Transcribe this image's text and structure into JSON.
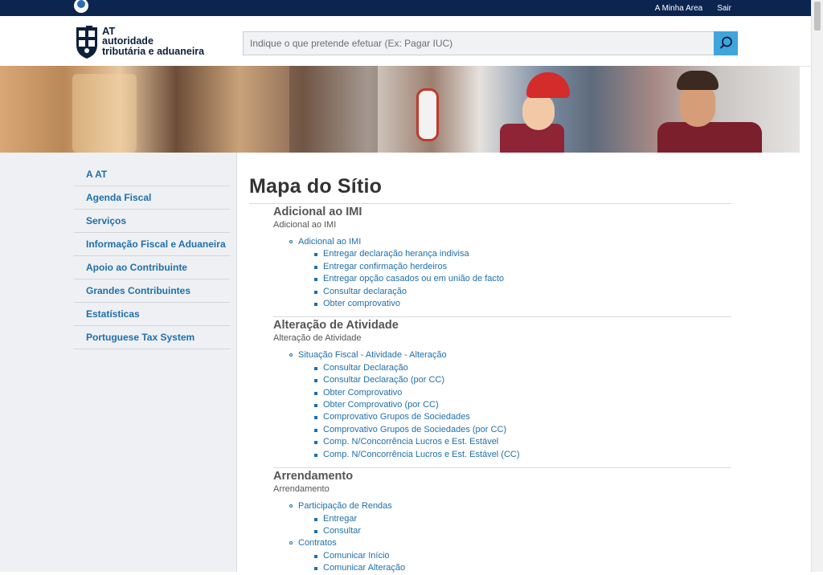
{
  "topbar": {
    "minha_area": "A Minha Area",
    "sair": "Sair",
    "icon": "globe-icon"
  },
  "header": {
    "logo": {
      "line1": "AT",
      "line2": "autoridade",
      "line3": "tributária e aduaneira"
    },
    "search": {
      "placeholder": "Indique o que pretende efetuar (Ex: Pagar IUC)",
      "value": "",
      "icon": "search-icon",
      "button_color": "#3fa5dd"
    }
  },
  "sidebar": {
    "items": [
      "A AT",
      "Agenda Fiscal",
      "Serviços",
      "Informação Fiscal e Aduaneira",
      "Apoio ao Contribuinte",
      "Grandes Contribuintes",
      "Estatísticas",
      "Portuguese Tax System"
    ]
  },
  "main": {
    "title": "Mapa do Sítio",
    "sections": [
      {
        "heading": "Adicional ao IMI",
        "subtitle": "Adicional ao IMI",
        "groups": [
          {
            "label": "Adicional ao IMI",
            "children": [
              "Entregar declaração herança indivisa",
              "Entregar confirmação herdeiros",
              "Entregar opção casados ou em união de facto",
              "Consultar declaração",
              "Obter comprovativo"
            ]
          }
        ]
      },
      {
        "heading": "Alteração de Atividade",
        "subtitle": "Alteração de Atividade",
        "groups": [
          {
            "label": "Situação Fiscal - Atividade - Alteração",
            "children": [
              "Consultar Declaração",
              "Consultar Declaração (por CC)",
              "Obter Comprovativo",
              "Obter Comprovativo (por CC)",
              "Comprovativo Grupos de Sociedades",
              "Comprovativo Grupos de Sociedades (por CC)",
              "Comp. N/Concorrência Lucros e Est. Estável",
              "Comp. N/Concorrência Lucros e Est. Estável (CC)"
            ]
          }
        ]
      },
      {
        "heading": "Arrendamento",
        "subtitle": "Arrendamento",
        "groups": [
          {
            "label": "Participação de Rendas",
            "children": [
              "Entregar",
              "Consultar"
            ]
          },
          {
            "label": "Contratos",
            "children": [
              "Comunicar Início",
              "Comunicar Alteração"
            ]
          }
        ]
      }
    ]
  }
}
